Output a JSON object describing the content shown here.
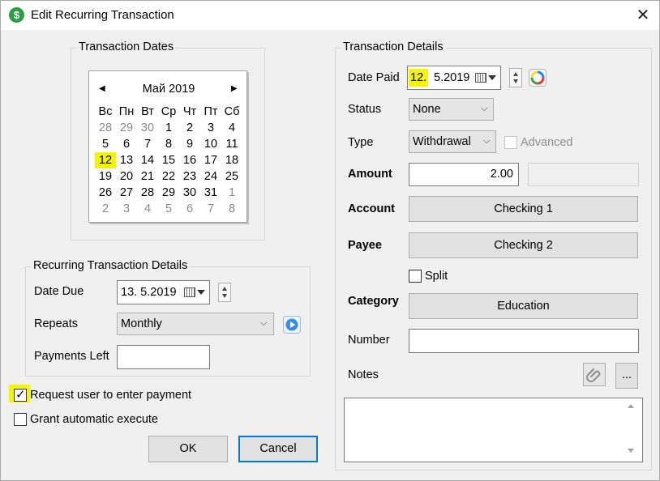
{
  "window": {
    "title": "Edit Recurring Transaction",
    "app_icon": "$",
    "close_glyph": "✕"
  },
  "dates_group": {
    "title": "Transaction Dates",
    "calendar": {
      "month_label": "Май 2019",
      "weekdays": [
        "Вс",
        "Пн",
        "Вт",
        "Ср",
        "Чт",
        "Пт",
        "Сб"
      ],
      "weeks": [
        [
          "28",
          "29",
          "30",
          "1",
          "2",
          "3",
          "4"
        ],
        [
          "5",
          "6",
          "7",
          "8",
          "9",
          "10",
          "11"
        ],
        [
          "12",
          "13",
          "14",
          "15",
          "16",
          "17",
          "18"
        ],
        [
          "19",
          "20",
          "21",
          "22",
          "23",
          "24",
          "25"
        ],
        [
          "26",
          "27",
          "28",
          "29",
          "30",
          "31",
          "1"
        ],
        [
          "2",
          "3",
          "4",
          "5",
          "6",
          "7",
          "8"
        ]
      ],
      "selected_day": "12"
    }
  },
  "recurring_group": {
    "title": "Recurring Transaction Details",
    "date_due_label": "Date Due",
    "date_due_value": "13.  5.2019",
    "repeats_label": "Repeats",
    "repeats_value": "Monthly",
    "payments_left_label": "Payments Left",
    "payments_left_value": ""
  },
  "options": {
    "request_user_label": "Request user to enter payment",
    "request_user_checked": true,
    "grant_auto_label": "Grant automatic execute",
    "grant_auto_checked": false
  },
  "buttons": {
    "ok": "OK",
    "cancel": "Cancel"
  },
  "details_group": {
    "title": "Transaction Details",
    "date_paid_label": "Date Paid",
    "date_paid_day": "12.",
    "date_paid_rest": "5.2019",
    "status_label": "Status",
    "status_value": "None",
    "type_label": "Type",
    "type_value": "Withdrawal",
    "advanced_label": "Advanced",
    "amount_label": "Amount",
    "amount_value": "2.00",
    "account_label": "Account",
    "account_value": "Checking 1",
    "payee_label": "Payee",
    "payee_value": "Checking 2",
    "split_label": "Split",
    "category_label": "Category",
    "category_value": "Education",
    "number_label": "Number",
    "number_value": "",
    "notes_label": "Notes",
    "notes_more": "...",
    "notes_value": ""
  },
  "colors": {
    "highlight": "#f5f500",
    "accent": "#0078d7",
    "app_icon": "#2e9e44"
  }
}
